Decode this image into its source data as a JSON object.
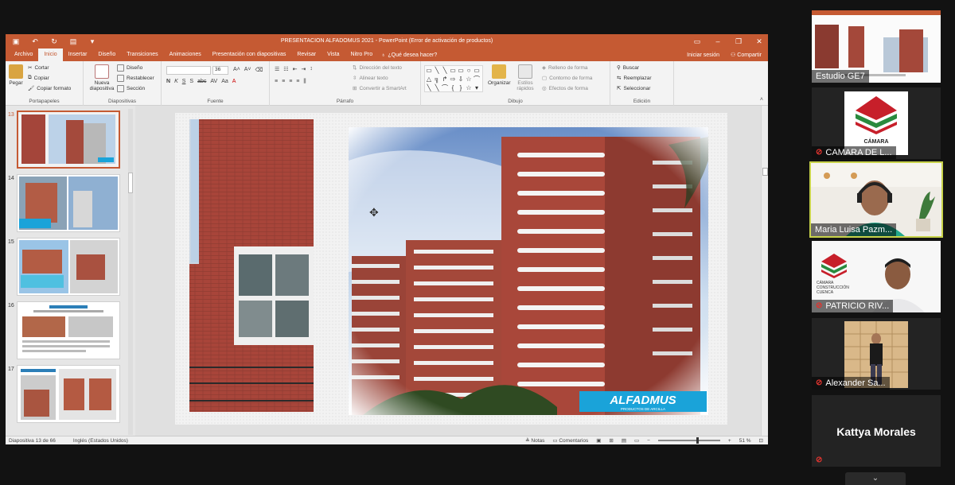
{
  "window": {
    "title": "PRESENTACION ALFADOMUS 2021 - PowerPoint (Error de activación de productos)"
  },
  "tabs": [
    {
      "label": "Archivo"
    },
    {
      "label": "Inicio"
    },
    {
      "label": "Insertar"
    },
    {
      "label": "Diseño"
    },
    {
      "label": "Transiciones"
    },
    {
      "label": "Animaciones"
    },
    {
      "label": "Presentación con diapositivas"
    },
    {
      "label": "Revisar"
    },
    {
      "label": "Vista"
    },
    {
      "label": "Nitro Pro"
    }
  ],
  "tell_me": "¿Qué desea hacer?",
  "signin": "Iniciar sesión",
  "share": "Compartir",
  "ribbon": {
    "portapapeles": {
      "label": "Portapapeles",
      "paste": "Pegar",
      "cut": "Cortar",
      "copy": "Copiar",
      "format": "Copiar formato"
    },
    "diapositivas": {
      "label": "Diapositivas",
      "new": "Nueva diapositiva",
      "layout": "Diseño",
      "reset": "Restablecer",
      "section": "Sección"
    },
    "fuente": {
      "label": "Fuente",
      "size": "36"
    },
    "parrafo": {
      "label": "Párrafo",
      "direction": "Dirección del texto",
      "align": "Alinear texto",
      "smartart": "Convertir a SmartArt"
    },
    "dibujo": {
      "label": "Dibujo",
      "arrange": "Organizar",
      "styles": "Estilos rápidos",
      "fill": "Relleno de forma",
      "outline": "Contorno de forma",
      "effects": "Efectos de forma"
    },
    "edicion": {
      "label": "Edición",
      "find": "Buscar",
      "replace": "Reemplazar",
      "select": "Seleccionar"
    }
  },
  "thumbnails": [
    {
      "num": "13"
    },
    {
      "num": "14"
    },
    {
      "num": "15"
    },
    {
      "num": "16"
    },
    {
      "num": "17"
    }
  ],
  "slide": {
    "logo_text": "ALFADMUS",
    "logo_sub": "PRODUCTOS DE ARCILLA"
  },
  "status": {
    "slide_count": "Diapositiva 13 de 66",
    "language": "Inglés (Estados Unidos)",
    "notes": "Notas",
    "comments": "Comentarios",
    "zoom": "51 %"
  },
  "participants": [
    {
      "name": "Estudio GE7",
      "muted": false
    },
    {
      "name": "CAMARA DE L...",
      "muted": true,
      "logo_text": "CÁMARA"
    },
    {
      "name": "Maria Luisa Pazm...",
      "muted": false
    },
    {
      "name": "PATRICIO RIV...",
      "muted": true,
      "logo_text": "CÁMARA CONSTRUCCIÓN CUENCA"
    },
    {
      "name": "Alexander Sa...",
      "muted": true
    },
    {
      "name": "Kattya Morales",
      "muted": true
    }
  ],
  "colors": {
    "ppt_accent": "#c55a33",
    "active_speaker": "#c8d34a",
    "muted_mic": "#e0342f",
    "logo_blue": "#1aa3d9"
  }
}
